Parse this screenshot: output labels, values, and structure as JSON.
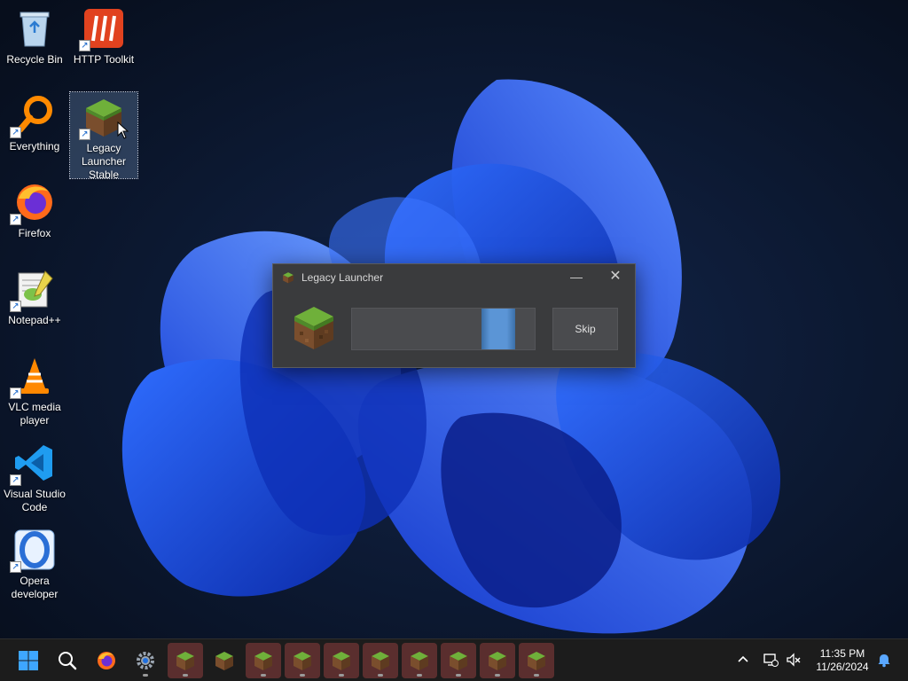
{
  "desktop": {
    "icons": [
      {
        "label": "Recycle Bin",
        "icon": "recycle-bin-icon"
      },
      {
        "label": "HTTP Toolkit",
        "icon": "http-toolkit-icon"
      },
      {
        "label": "Everything",
        "icon": "everything-search-icon"
      },
      {
        "label": "Legacy Launcher Stable",
        "icon": "grass-block-icon"
      },
      {
        "label": "Firefox",
        "icon": "firefox-icon"
      },
      {
        "label": "Notepad++",
        "icon": "notepad-plus-plus-icon"
      },
      {
        "label": "VLC media player",
        "icon": "vlc-icon"
      },
      {
        "label": "Visual Studio Code",
        "icon": "vscode-icon"
      },
      {
        "label": "Opera developer",
        "icon": "opera-icon"
      }
    ],
    "selected": "Legacy Launcher Stable"
  },
  "dialog": {
    "title": "Legacy Launcher",
    "skip_label": "Skip",
    "minimize_glyph": "—",
    "close_glyph": "✕"
  },
  "taskbar": {
    "items": [
      "start-icon",
      "search-icon",
      "firefox-icon",
      "settings-icon",
      "grass-block-icon"
    ],
    "running_apps_count": 10,
    "clock": {
      "time": "11:35 PM",
      "date": "11/26/2024"
    }
  },
  "colors": {
    "accent": "#5b95d6",
    "dialog_bg": "#3a3b3d",
    "taskbar_bg": "#1c1c1c",
    "app_highlight": "#5a2e2e"
  }
}
